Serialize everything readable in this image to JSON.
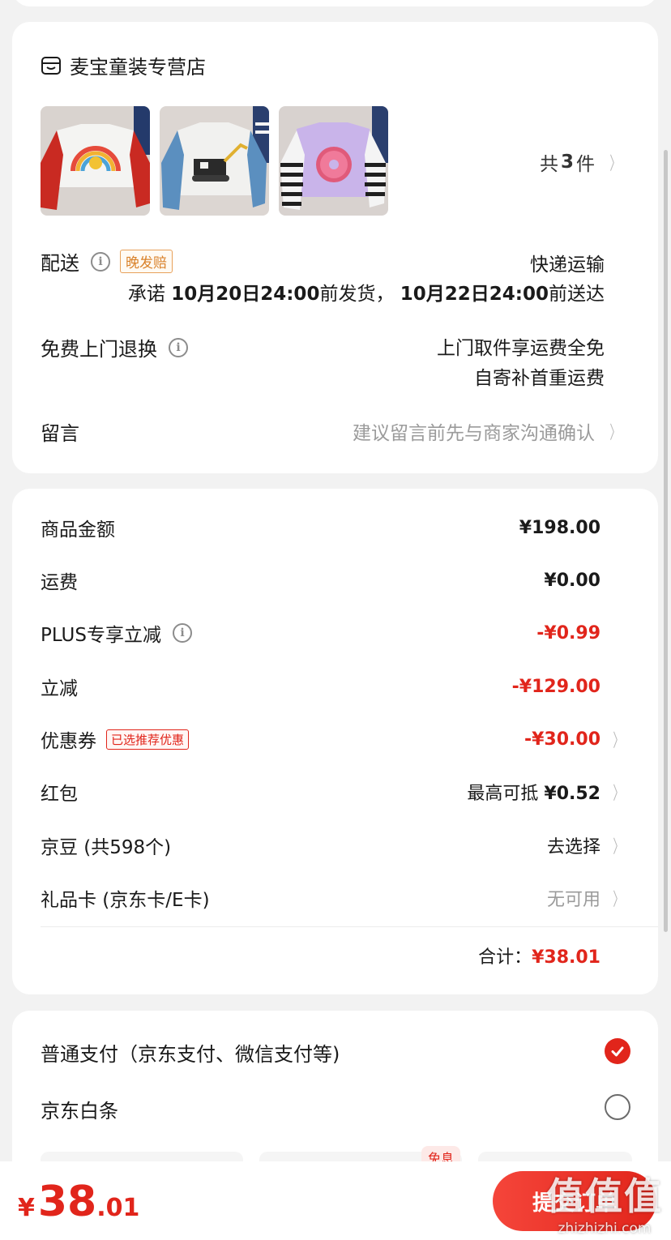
{
  "store": {
    "name": "麦宝童装专营店",
    "count_prefix": "共",
    "count_num": "3",
    "count_suffix": "件"
  },
  "delivery": {
    "label": "配送",
    "badge": "晚发赔",
    "method": "快递运输",
    "promise_1": "承诺",
    "ship_date": "10月20日24:00",
    "promise_2": "前发货，",
    "arrive_date": "10月22日24:00",
    "promise_3": "前送达"
  },
  "returns": {
    "label": "免费上门退换",
    "line1": "上门取件享运费全免",
    "line2": "自寄补首重运费"
  },
  "message": {
    "label": "留言",
    "placeholder": "建议留言前先与商家沟通确认"
  },
  "price": {
    "goods_label": "商品金额",
    "goods_value": "¥198.00",
    "shipping_label": "运费",
    "shipping_value": "¥0.00",
    "plus_label": "PLUS专享立减",
    "plus_value": "-¥0.99",
    "discount_label": "立减",
    "discount_value": "-¥129.00",
    "coupon_label": "优惠券",
    "coupon_badge": "已选推荐优惠",
    "coupon_value": "-¥30.00",
    "redpacket_label": "红包",
    "redpacket_prefix": "最高可抵",
    "redpacket_value": "¥0.52",
    "beans_label": "京豆 (共598个)",
    "beans_value": "去选择",
    "giftcard_label": "礼品卡 (京东卡/E卡)",
    "giftcard_value": "无可用",
    "total_label": "合计：",
    "total_value": "¥38.01"
  },
  "payment": {
    "normal": "普通支付（京东支付、微信支付等)",
    "baitiao": "京东白条",
    "free_tag": "免息"
  },
  "bottom": {
    "currency": "¥",
    "amount_int": "38",
    "amount_dec": ".01",
    "submit": "提交订单"
  },
  "watermark": {
    "big": "值值值",
    "small": "zhizhizhi.com"
  },
  "colors": {
    "accent": "#e1251b",
    "late_badge": "#d9822b"
  }
}
